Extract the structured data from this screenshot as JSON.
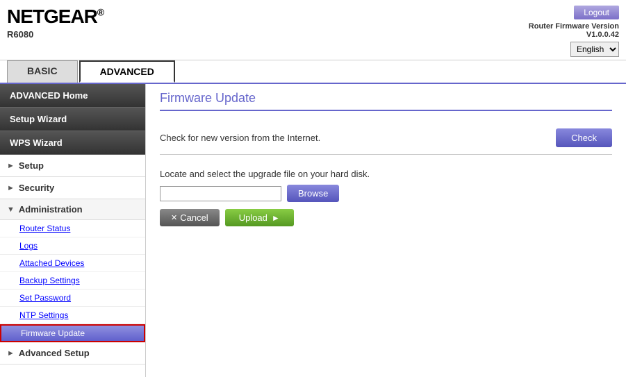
{
  "logo": {
    "text": "NETGEAR",
    "registered": "®",
    "model": "R6080"
  },
  "header": {
    "logout_label": "Logout",
    "firmware_version_label": "Router Firmware Version",
    "firmware_version": "V1.0.0.42"
  },
  "language": {
    "selected": "English",
    "options": [
      "English"
    ]
  },
  "tabs": [
    {
      "id": "basic",
      "label": "BASIC"
    },
    {
      "id": "advanced",
      "label": "ADVANCED"
    }
  ],
  "sidebar": {
    "advanced_home": "ADVANCED Home",
    "setup_wizard": "Setup Wizard",
    "wps_wizard": "WPS Wizard",
    "sections": [
      {
        "id": "setup",
        "label": "Setup",
        "expanded": false
      },
      {
        "id": "security",
        "label": "Security",
        "expanded": false
      },
      {
        "id": "administration",
        "label": "Administration",
        "expanded": true,
        "links": [
          "Router Status",
          "Logs",
          "Attached Devices",
          "Backup Settings",
          "Set Password",
          "NTP Settings",
          "Firmware Update"
        ]
      },
      {
        "id": "advanced-setup",
        "label": "Advanced Setup",
        "expanded": false
      }
    ]
  },
  "content": {
    "page_title": "Firmware Update",
    "check_text": "Check for new version from the Internet.",
    "check_button": "Check",
    "upload_label": "Locate and select the upgrade file on your hard disk.",
    "browse_button": "Browse",
    "cancel_button": "Cancel",
    "upload_button": "Upload",
    "file_placeholder": ""
  }
}
